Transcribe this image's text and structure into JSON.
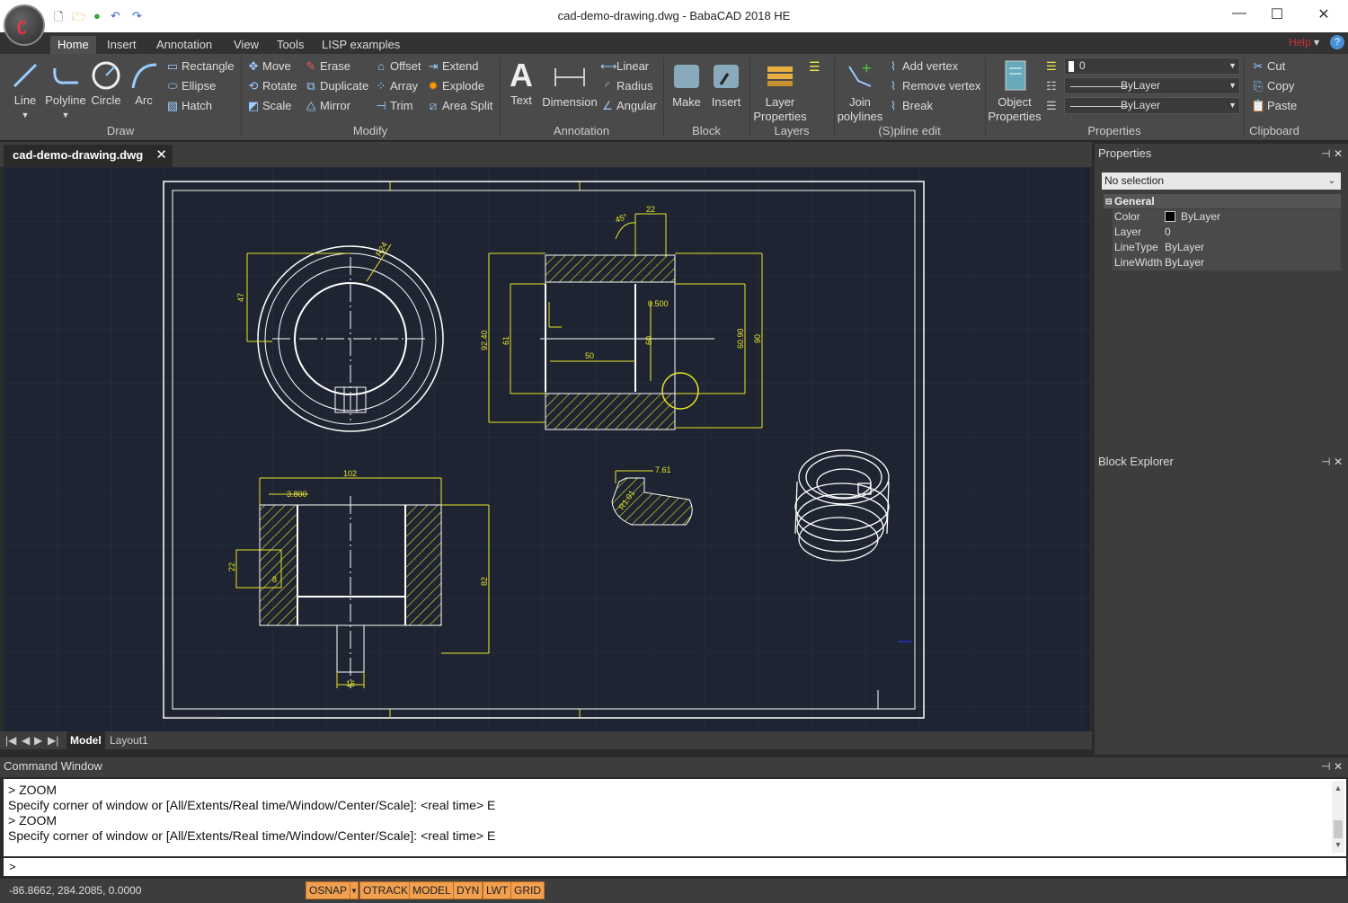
{
  "titlebar": {
    "title": "cad-demo-drawing.dwg - BabaCAD 2018 HE",
    "minimize": "—",
    "maximize": "☐",
    "close": "✕"
  },
  "ribbon_tabs": [
    "Home",
    "Insert",
    "Annotation",
    "View",
    "Tools",
    "LISP examples"
  ],
  "help": {
    "label": "Help",
    "menu": "▾",
    "icon": "?"
  },
  "draw": {
    "label": "Draw",
    "line": "Line",
    "polyline": "Polyline",
    "circle": "Circle",
    "arc": "Arc",
    "rectangle": "Rectangle",
    "ellipse": "Ellipse",
    "hatch": "Hatch"
  },
  "modify": {
    "label": "Modify",
    "move": "Move",
    "rotate": "Rotate",
    "scale": "Scale",
    "erase": "Erase",
    "duplicate": "Duplicate",
    "mirror": "Mirror",
    "offset": "Offset",
    "array": "Array",
    "trim": "Trim",
    "extend": "Extend",
    "explode": "Explode",
    "area_split": "Area Split"
  },
  "annotation": {
    "label": "Annotation",
    "text": "Text",
    "dimension": "Dimension",
    "linear": "Linear",
    "radius": "Radius",
    "angular": "Angular"
  },
  "block": {
    "label": "Block",
    "make": "Make",
    "insert": "Insert"
  },
  "layers": {
    "label": "Layers",
    "layer_properties": "Layer Properties"
  },
  "spline_edit": {
    "label": "(S)pline edit",
    "join": "Join polylines",
    "add_vertex": "Add vertex",
    "remove_vertex": "Remove vertex",
    "break": "Break"
  },
  "properties_group": {
    "label": "Properties",
    "object_properties": "Object Properties",
    "layer_value": "0",
    "linetype": "ByLayer",
    "linewidth": "ByLayer"
  },
  "clipboard": {
    "label": "Clipboard",
    "cut": "Cut",
    "copy": "Copy",
    "paste": "Paste"
  },
  "doc_tab": {
    "name": "cad-demo-drawing.dwg",
    "close": "✕"
  },
  "drawing": {
    "dims": [
      "47",
      "R24",
      "45°",
      "22",
      "0.500",
      "92.40",
      "61",
      "60",
      "50",
      "60.90",
      "90",
      "102",
      "3.800",
      "7.61",
      "R1.01",
      "22",
      "8",
      "82",
      "16"
    ]
  },
  "layout_tabs": {
    "nav": [
      "|◀",
      "◀",
      "▶",
      "▶|"
    ],
    "model": "Model",
    "layout": "Layout1"
  },
  "properties_panel": {
    "title": "Properties",
    "pin": "⊣",
    "close": "✕",
    "selection": "No selection",
    "category": "General",
    "rows": [
      {
        "key": "Color",
        "value": "ByLayer"
      },
      {
        "key": "Layer",
        "value": "0"
      },
      {
        "key": "LineType",
        "value": "ByLayer"
      },
      {
        "key": "LineWidth",
        "value": "ByLayer"
      }
    ]
  },
  "block_explorer": {
    "title": "Block Explorer"
  },
  "command_window": {
    "title": "Command Window",
    "lines": [
      "> ZOOM",
      "Specify corner of window or [All/Extents/Real time/Window/Center/Scale]: <real time> E",
      "> ZOOM",
      "Specify corner of window or [All/Extents/Real time/Window/Center/Scale]: <real time> E"
    ],
    "prompt": ">"
  },
  "status": {
    "coords": "-86.8662, 284.2085, 0.0000",
    "toggles": [
      "OSNAP",
      "OTRACK",
      "MODEL",
      "DYN",
      "LWT",
      "GRID"
    ]
  },
  "colors": {
    "accent": "#f0a050",
    "canvas": "#1e2431",
    "dimension": "#e6e629",
    "geometry": "#ffffff"
  }
}
